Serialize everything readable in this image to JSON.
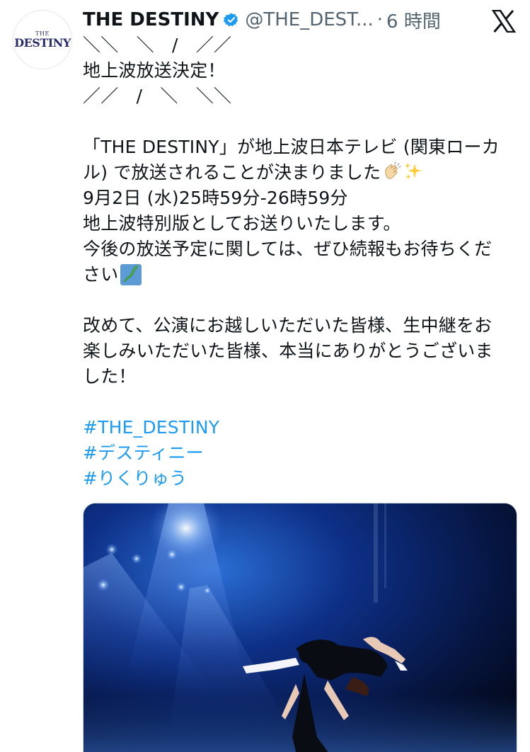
{
  "author": {
    "avatar_small": "THE",
    "avatar_big": "DESTINY",
    "display_name": "THE DESTINY",
    "handle": "@THE_DEST...",
    "separator": "·",
    "time": "6 時間"
  },
  "icons": {
    "verified": "verified-badge-icon",
    "logo": "x-logo-icon"
  },
  "colors": {
    "hashtag": "#1d9bf0",
    "verified": "#1d9bf0",
    "secondary_text": "#536471"
  },
  "post": {
    "line_1": "＼＼　＼　/　／／",
    "line_2": "地上波放送決定！",
    "line_3": "／／　/　＼　＼＼",
    "line_4": "「THE DESTINY」が地上波日本テレビ (関東ローカ",
    "line_5": "ル) で放送されることが決まりました",
    "line_6": "9月2日 (水)25時59分-26時59分",
    "line_7": "地上波特別版としてお送りいたします。",
    "line_8": "今後の放送予定に関しては、ぜひ続報もお待ちくだ",
    "line_9": "さい",
    "line_10": "改めて、公演にお越しいただいた皆様、生中継をお",
    "line_11": "楽しみいただいた皆様、本当にありがとうございま",
    "line_12": "した！",
    "hashtags": [
      "#THE_DESTINY",
      "#デスティニー",
      "#りくりゅう"
    ]
  },
  "emojis": [
    "clapping-hands-icon",
    "sparkles-icon",
    "japan-map-icon"
  ]
}
